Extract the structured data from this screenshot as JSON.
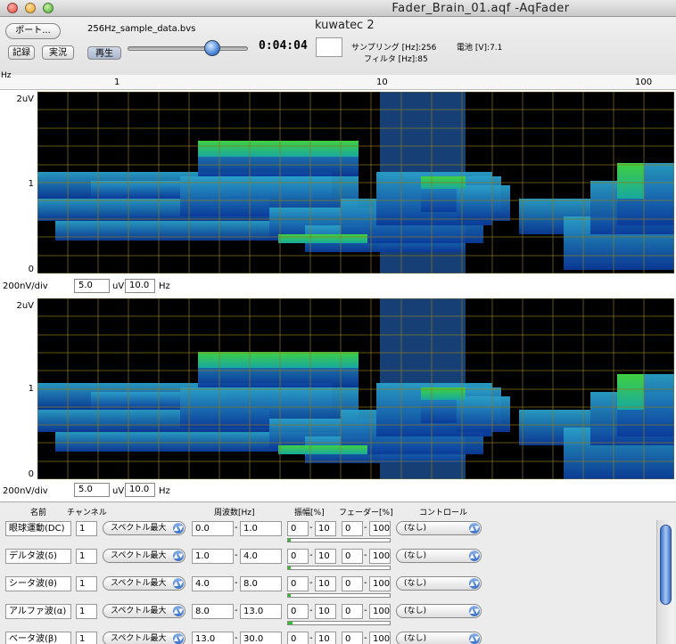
{
  "window": {
    "title": "Fader_Brain_01.aqf -AqFader"
  },
  "toolbar": {
    "port_label": "ポート...",
    "record_label": "記録",
    "live_label": "実況",
    "play_label": "再生",
    "filename": "256Hz_sample_data.bvs",
    "time": "0:04:04",
    "device_name": "kuwatec 2",
    "sampling_label": "サンプリング [Hz]:",
    "sampling_value": "256",
    "filter_label": "フィルタ [Hz]:",
    "filter_value": "85",
    "battery_label": "電池 [V]:",
    "battery_value": "7.1",
    "playback_position": 0.7
  },
  "axis": {
    "unit": "Hz",
    "ticks": [
      "1",
      "10",
      "100"
    ]
  },
  "panels": [
    {
      "y_ticks": [
        "2uV",
        "1",
        "0"
      ],
      "div_label": "200nV/div",
      "amplitude": "5.0",
      "amplitude_unit": "uV",
      "freq": "10.0",
      "freq_unit": "Hz"
    },
    {
      "y_ticks": [
        "2uV",
        "1",
        "0"
      ],
      "div_label": "200nV/div",
      "amplitude": "5.0",
      "amplitude_unit": "uV",
      "freq": "10.0",
      "freq_unit": "Hz"
    }
  ],
  "table": {
    "headers": {
      "name": "名前",
      "channel": "チャンネル",
      "freq": "周波数[Hz]",
      "amp": "振幅[%]",
      "fader": "フェーダー[%]",
      "control": "コントロール"
    },
    "rows": [
      {
        "name": "眼球運動(DC)",
        "channel": "1",
        "mode": "スペクトル最大",
        "f_lo": "0.0",
        "f_hi": "1.0",
        "a_lo": "0",
        "a_hi": "10",
        "fd_lo": "0",
        "fd_hi": "100",
        "control": "(なし)",
        "level": 0.0
      },
      {
        "name": "デルタ波(δ)",
        "channel": "1",
        "mode": "スペクトル最大",
        "f_lo": "1.0",
        "f_hi": "4.0",
        "a_lo": "0",
        "a_hi": "10",
        "fd_lo": "0",
        "fd_hi": "100",
        "control": "(なし)",
        "level": 0.03
      },
      {
        "name": "シータ波(θ)",
        "channel": "1",
        "mode": "スペクトル最大",
        "f_lo": "4.0",
        "f_hi": "8.0",
        "a_lo": "0",
        "a_hi": "10",
        "fd_lo": "0",
        "fd_hi": "100",
        "control": "(なし)",
        "level": 0.03
      },
      {
        "name": "アルファ波(α)",
        "channel": "1",
        "mode": "スペクトル最大",
        "f_lo": "8.0",
        "f_hi": "13.0",
        "a_lo": "0",
        "a_hi": "10",
        "fd_lo": "0",
        "fd_hi": "100",
        "control": "(なし)",
        "level": 0.04
      },
      {
        "name": "ベータ波(β)",
        "channel": "1",
        "mode": "スペクトル最大",
        "f_lo": "13.0",
        "f_hi": "30.0",
        "a_lo": "0",
        "a_hi": "10",
        "fd_lo": "0",
        "fd_hi": "100",
        "control": "(なし)",
        "level": 0.0
      }
    ]
  },
  "colors": {
    "plot_bg": "#000000",
    "grid": "#8a7a20",
    "band_highlight": "#1a4a8a",
    "meter": "#2cc030"
  }
}
